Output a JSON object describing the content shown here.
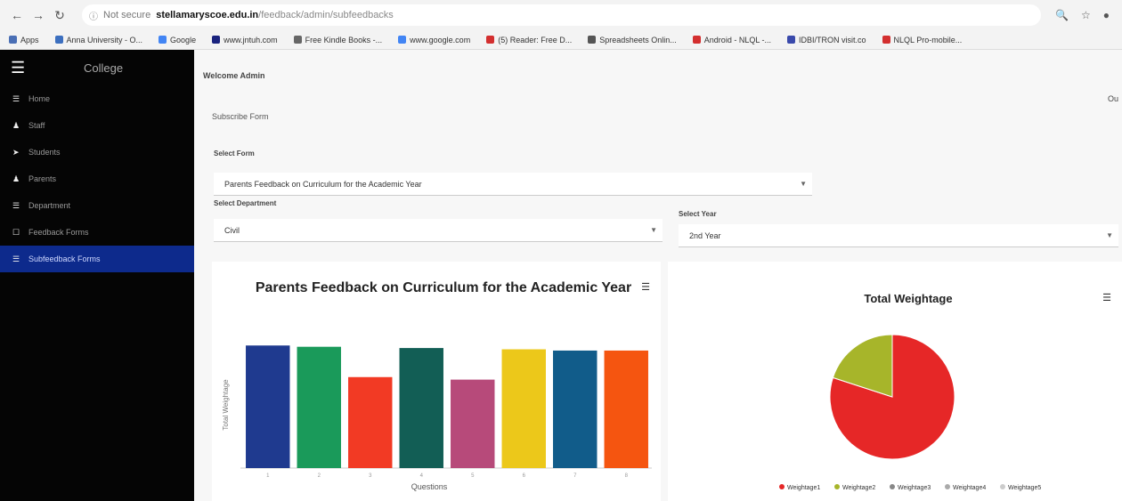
{
  "browser": {
    "url_secure": "Not secure",
    "url_domain": "stellamaryscoe.edu.in",
    "url_path": "/feedback/admin/subfeedbacks",
    "bookmarks": [
      {
        "label": "Apps",
        "color": "#4a6fb5"
      },
      {
        "label": "Anna University - O...",
        "color": "#3c6fbf"
      },
      {
        "label": "Google",
        "color": "#4285f4"
      },
      {
        "label": "www.jntuh.com",
        "color": "#1a237e"
      },
      {
        "label": "Free Kindle Books -...",
        "color": "#666666"
      },
      {
        "label": "www.google.com",
        "color": "#4285f4"
      },
      {
        "label": "(5) Reader: Free D...",
        "color": "#d32f2f"
      },
      {
        "label": "Spreadsheets Onlin...",
        "color": "#555555"
      },
      {
        "label": "Android - NLQL -...",
        "color": "#d32f2f"
      },
      {
        "label": "IDBI/TRON visit.co",
        "color": "#3949ab"
      },
      {
        "label": "NLQL Pro-mobile...",
        "color": "#d32f2f"
      }
    ]
  },
  "sidebar": {
    "brand": "College",
    "items": [
      {
        "label": "Home",
        "active": false
      },
      {
        "label": "Staff",
        "active": false
      },
      {
        "label": "Students",
        "active": false
      },
      {
        "label": "Parents",
        "active": false
      },
      {
        "label": "Department",
        "active": false
      },
      {
        "label": "Feedback Forms",
        "active": false
      },
      {
        "label": "Subfeedback Forms",
        "active": true
      }
    ]
  },
  "main": {
    "welcome": "Welcome Admin",
    "logout": "Ou",
    "subtitle": "Subscribe Form",
    "form_label": "Select Form",
    "form_value": "Parents Feedback on Curriculum for the Academic Year",
    "dept_label": "Select Department",
    "dept_value": "Civil",
    "year_label": "Select Year",
    "year_value": "2nd Year"
  },
  "chart_data": [
    {
      "type": "bar",
      "title": "Parents Feedback on Curriculum for the Academic Year",
      "xlabel": "Questions",
      "ylabel": "Total Weightage",
      "categories": [
        "1",
        "2",
        "3",
        "4",
        "5",
        "6",
        "7",
        "8"
      ],
      "values": [
        97,
        96,
        72,
        95,
        70,
        94,
        93,
        93
      ],
      "colors": [
        "#1f3a8f",
        "#1a9a5a",
        "#f23a24",
        "#125e55",
        "#b74a7a",
        "#ecc81a",
        "#115c8a",
        "#f55510"
      ],
      "ylim": [
        0,
        100
      ],
      "grid": false
    },
    {
      "type": "pie",
      "title": "Total Weightage",
      "labels": [
        "Weightage1",
        "Weightage2",
        "Weightage3",
        "Weightage4",
        "Weightage5"
      ],
      "values": [
        80,
        20,
        0,
        0,
        0
      ],
      "colors": [
        "#e62727",
        "#a7b52a",
        "#888888",
        "#aaaaaa",
        "#cccccc"
      ],
      "legend_position": "bottom"
    }
  ]
}
